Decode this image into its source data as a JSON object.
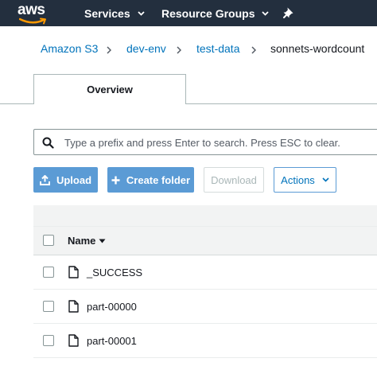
{
  "header": {
    "logo_text": "aws",
    "services_label": "Services",
    "resource_groups_label": "Resource Groups",
    "pin_icon": "pin-icon"
  },
  "breadcrumb": {
    "items": [
      "Amazon S3",
      "dev-env",
      "test-data",
      "sonnets-wordcount"
    ]
  },
  "tabs": {
    "overview_label": "Overview"
  },
  "search": {
    "placeholder": "Type a prefix and press Enter to search. Press ESC to clear.",
    "value": ""
  },
  "toolbar": {
    "upload_label": "Upload",
    "create_folder_label": "Create folder",
    "download_label": "Download",
    "actions_label": "Actions"
  },
  "table": {
    "columns": [
      "Name"
    ],
    "rows": [
      {
        "name": "_SUCCESS"
      },
      {
        "name": "part-00000"
      },
      {
        "name": "part-00001"
      }
    ]
  },
  "colors": {
    "header_bg": "#232f3e",
    "link": "#0073bb",
    "primary_button": "#5b9bd5"
  }
}
